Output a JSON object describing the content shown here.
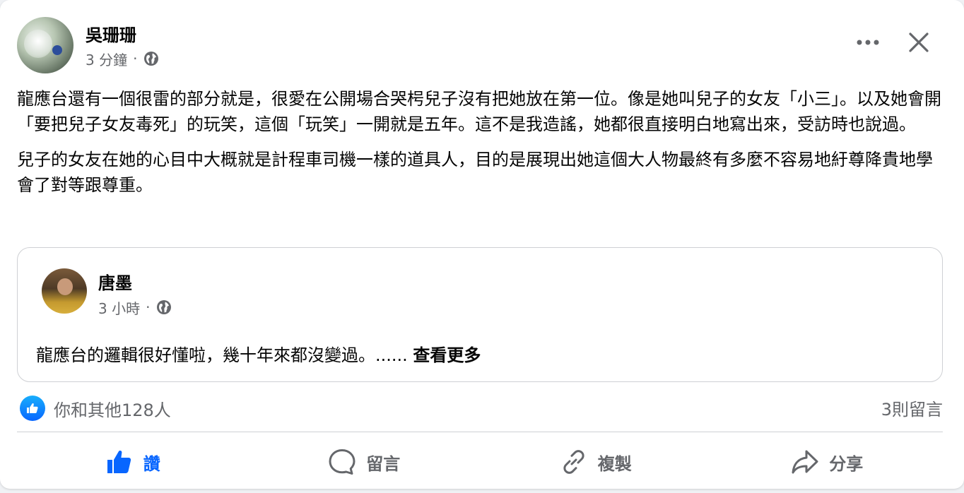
{
  "post": {
    "author": "吳珊珊",
    "time": "3 分鐘",
    "separator": "·",
    "privacy_icon": "globe-icon",
    "paragraphs": [
      "龍應台還有一個很雷的部分就是，很愛在公開場合哭枵兒子沒有把她放在第一位。像是她叫兒子的女友「小三」。以及她會開「要把兒子女友毒死」的玩笑，這個「玩笑」一開就是五年。這不是我造謠，她都很直接明白地寫出來，受訪時也說過。",
      "兒子的女友在她的心目中大概就是計程車司機一樣的道具人，目的是展現出她這個大人物最終有多麼不容易地紆尊降貴地學會了對等跟尊重。"
    ]
  },
  "shared": {
    "author": "唐墨",
    "time": "3 小時",
    "separator": "·",
    "text": "龍應台的邏輯很好懂啦，幾十年來都沒變過。......",
    "see_more": "查看更多"
  },
  "reactions": {
    "summary": "你和其他128人",
    "comments": "3則留言"
  },
  "actions": [
    {
      "label": "讚",
      "icon": "thumbs-up-icon",
      "active": true
    },
    {
      "label": "留言",
      "icon": "comment-icon",
      "active": false
    },
    {
      "label": "複製",
      "icon": "link-icon",
      "active": false
    },
    {
      "label": "分享",
      "icon": "share-icon",
      "active": false
    }
  ],
  "colors": {
    "accent": "#0866ff",
    "secondary_text": "#65676b",
    "primary_text": "#050505"
  }
}
